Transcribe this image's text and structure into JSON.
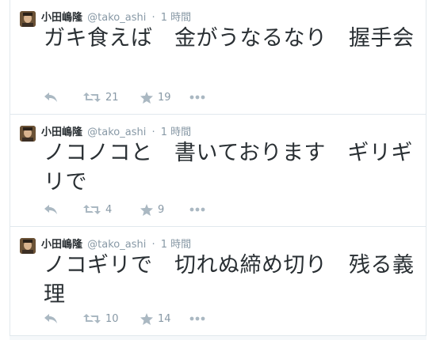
{
  "tweets": [
    {
      "name": "小田嶋隆",
      "handle": "@tako_ashi",
      "separator": "·",
      "time": "1 時間",
      "text": "ガキ食えば　金がうなるなり　握手会",
      "retweets": "21",
      "favorites": "19"
    },
    {
      "name": "小田嶋隆",
      "handle": "@tako_ashi",
      "separator": "·",
      "time": "1 時間",
      "text": "ノコノコと　書いております　ギリギリで",
      "retweets": "4",
      "favorites": "9"
    },
    {
      "name": "小田嶋隆",
      "handle": "@tako_ashi",
      "separator": "·",
      "time": "1 時間",
      "text": "ノコギリで　切れぬ締め切り　残る義理",
      "retweets": "10",
      "favorites": "14"
    }
  ],
  "icons": {
    "reply": "reply-icon",
    "retweet": "retweet-icon",
    "favorite": "star-icon",
    "more": "more-dots-icon"
  },
  "colors": {
    "text": "#292f33",
    "meta": "#8899a6",
    "icon": "#aab8c2",
    "border": "#e1e8ed"
  }
}
